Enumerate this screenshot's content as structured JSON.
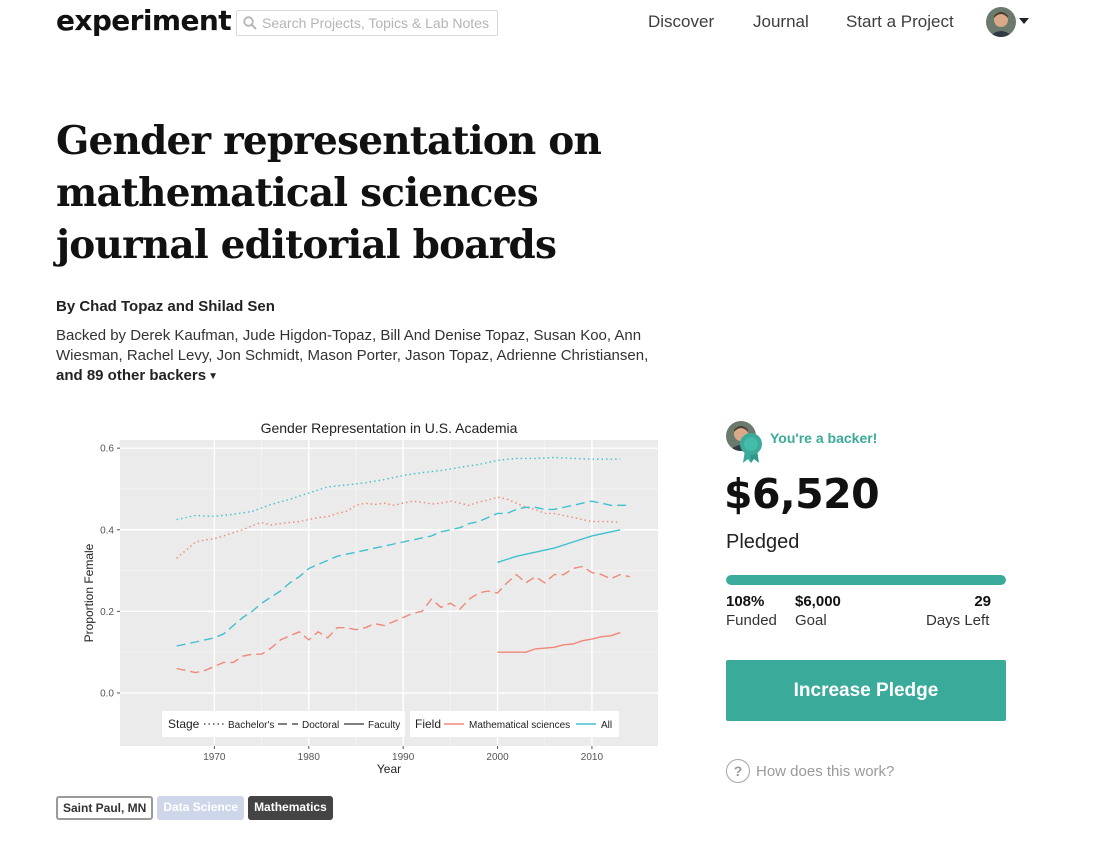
{
  "header": {
    "logo": "experiment",
    "search_placeholder": "Search Projects, Topics & Lab Notes",
    "nav": {
      "discover": "Discover",
      "journal": "Journal",
      "start": "Start a Project"
    }
  },
  "project": {
    "title": "Gender representation on mathematical sciences journal editorial boards",
    "authors": "By Chad Topaz and Shilad Sen",
    "backers_text": "Backed by Derek Kaufman, Jude Higdon-Topaz, Bill And Denise Topaz, Susan Koo, Ann Wiesman, Rachel Levy, Jon Schmidt, Mason Porter, Jason Topaz, Adrienne Christiansen,",
    "more_backers": "and 89 other backers",
    "tags": {
      "location": "Saint Paul, MN",
      "category1": "Data Science",
      "category2": "Mathematics"
    }
  },
  "sidebar": {
    "backer_status": "You're a backer!",
    "amount": "$6,520",
    "amount_label": "Pledged",
    "funded_pct": "108%",
    "funded_label": "Funded",
    "goal": "$6,000",
    "goal_label": "Goal",
    "days": "29",
    "days_label": "Days Left",
    "progress": 1.0,
    "button": "Increase Pledge",
    "how": "How does this work?"
  },
  "colors": {
    "accent": "#3aab9b",
    "math_series": "#f08878",
    "all_series": "#40c0d0",
    "panel": "#ebebeb"
  },
  "chart_data": {
    "type": "line",
    "title": "Gender Representation in U.S. Academia",
    "xlabel": "Year",
    "ylabel": "Proportion Female",
    "xlim": [
      1960,
      2017
    ],
    "ylim": [
      -0.13,
      0.62
    ],
    "xticks": [
      1970,
      1980,
      1990,
      2000,
      2010
    ],
    "yticks": [
      0.0,
      0.2,
      0.4,
      0.6
    ],
    "ytick_labels": [
      "0.0",
      "0.2",
      "0.4",
      "0.6"
    ],
    "grid": true,
    "legend": {
      "position": "bottom",
      "stage_title": "Stage",
      "stage_items": [
        "Bachelor's",
        "Doctoral",
        "Faculty"
      ],
      "field_title": "Field",
      "field_items": [
        "Mathematical sciences",
        "All"
      ]
    },
    "series": [
      {
        "name": "Mathematical sciences - Bachelor's",
        "field": "math",
        "stage": "bachelors",
        "x": [
          1966,
          1967,
          1968,
          1969,
          1970,
          1971,
          1972,
          1973,
          1974,
          1975,
          1976,
          1977,
          1978,
          1979,
          1980,
          1981,
          1982,
          1983,
          1984,
          1985,
          1986,
          1987,
          1988,
          1989,
          1990,
          1991,
          1992,
          1993,
          1994,
          1995,
          1996,
          1997,
          1998,
          1999,
          2000,
          2001,
          2002,
          2003,
          2004,
          2005,
          2006,
          2007,
          2008,
          2009,
          2010,
          2011,
          2012,
          2013
        ],
        "y": [
          0.33,
          0.35,
          0.37,
          0.375,
          0.378,
          0.385,
          0.393,
          0.4,
          0.41,
          0.418,
          0.412,
          0.415,
          0.418,
          0.42,
          0.425,
          0.43,
          0.432,
          0.44,
          0.445,
          0.46,
          0.465,
          0.462,
          0.465,
          0.46,
          0.465,
          0.47,
          0.468,
          0.463,
          0.465,
          0.47,
          0.465,
          0.46,
          0.468,
          0.473,
          0.48,
          0.475,
          0.465,
          0.455,
          0.45,
          0.44,
          0.44,
          0.435,
          0.43,
          0.425,
          0.42,
          0.42,
          0.42,
          0.418
        ]
      },
      {
        "name": "All - Bachelor's",
        "field": "all",
        "stage": "bachelors",
        "x": [
          1966,
          1968,
          1970,
          1972,
          1974,
          1976,
          1978,
          1980,
          1982,
          1984,
          1986,
          1988,
          1990,
          1992,
          1994,
          1996,
          1998,
          2000,
          2002,
          2004,
          2006,
          2008,
          2010,
          2013
        ],
        "y": [
          0.425,
          0.435,
          0.433,
          0.438,
          0.445,
          0.462,
          0.475,
          0.49,
          0.505,
          0.51,
          0.515,
          0.523,
          0.533,
          0.54,
          0.545,
          0.553,
          0.56,
          0.57,
          0.575,
          0.575,
          0.577,
          0.575,
          0.573,
          0.573
        ]
      },
      {
        "name": "Mathematical sciences - Doctoral",
        "field": "math",
        "stage": "doctoral",
        "x": [
          1966,
          1967,
          1968,
          1969,
          1970,
          1971,
          1972,
          1973,
          1974,
          1975,
          1976,
          1977,
          1978,
          1979,
          1980,
          1981,
          1982,
          1983,
          1984,
          1985,
          1986,
          1987,
          1988,
          1989,
          1990,
          1991,
          1992,
          1993,
          1994,
          1995,
          1996,
          1997,
          1998,
          1999,
          2000,
          2001,
          2002,
          2003,
          2004,
          2005,
          2006,
          2007,
          2008,
          2009,
          2010,
          2011,
          2012,
          2013,
          2014
        ],
        "y": [
          0.06,
          0.055,
          0.05,
          0.055,
          0.065,
          0.075,
          0.075,
          0.09,
          0.095,
          0.095,
          0.11,
          0.13,
          0.14,
          0.15,
          0.13,
          0.15,
          0.135,
          0.16,
          0.16,
          0.155,
          0.16,
          0.17,
          0.165,
          0.175,
          0.185,
          0.195,
          0.2,
          0.23,
          0.21,
          0.22,
          0.205,
          0.23,
          0.245,
          0.25,
          0.245,
          0.27,
          0.29,
          0.27,
          0.285,
          0.27,
          0.29,
          0.29,
          0.305,
          0.31,
          0.295,
          0.29,
          0.28,
          0.29,
          0.285
        ]
      },
      {
        "name": "All - Doctoral",
        "field": "all",
        "stage": "doctoral",
        "x": [
          1966,
          1967,
          1968,
          1969,
          1970,
          1971,
          1972,
          1973,
          1974,
          1975,
          1976,
          1977,
          1978,
          1979,
          1980,
          1981,
          1982,
          1983,
          1984,
          1985,
          1986,
          1987,
          1988,
          1989,
          1990,
          1991,
          1992,
          1993,
          1994,
          1995,
          1996,
          1997,
          1998,
          1999,
          2000,
          2001,
          2002,
          2003,
          2004,
          2005,
          2006,
          2007,
          2008,
          2009,
          2010,
          2011,
          2012,
          2013,
          2014
        ],
        "y": [
          0.115,
          0.12,
          0.125,
          0.13,
          0.135,
          0.145,
          0.165,
          0.185,
          0.2,
          0.22,
          0.235,
          0.25,
          0.27,
          0.285,
          0.305,
          0.315,
          0.325,
          0.335,
          0.34,
          0.345,
          0.35,
          0.355,
          0.36,
          0.365,
          0.37,
          0.375,
          0.38,
          0.385,
          0.395,
          0.4,
          0.405,
          0.415,
          0.42,
          0.43,
          0.44,
          0.44,
          0.45,
          0.455,
          0.455,
          0.45,
          0.45,
          0.455,
          0.46,
          0.465,
          0.47,
          0.465,
          0.46,
          0.46,
          0.46
        ]
      },
      {
        "name": "Mathematical sciences - Faculty",
        "field": "math",
        "stage": "faculty",
        "x": [
          2000,
          2003,
          2004,
          2006,
          2007,
          2008,
          2009,
          2010,
          2011,
          2012,
          2013
        ],
        "y": [
          0.1,
          0.1,
          0.108,
          0.112,
          0.118,
          0.12,
          0.128,
          0.132,
          0.138,
          0.14,
          0.148
        ]
      },
      {
        "name": "All - Faculty",
        "field": "all",
        "stage": "faculty",
        "x": [
          2000,
          2002,
          2004,
          2006,
          2008,
          2010,
          2013
        ],
        "y": [
          0.32,
          0.335,
          0.345,
          0.355,
          0.37,
          0.385,
          0.4
        ]
      }
    ]
  }
}
